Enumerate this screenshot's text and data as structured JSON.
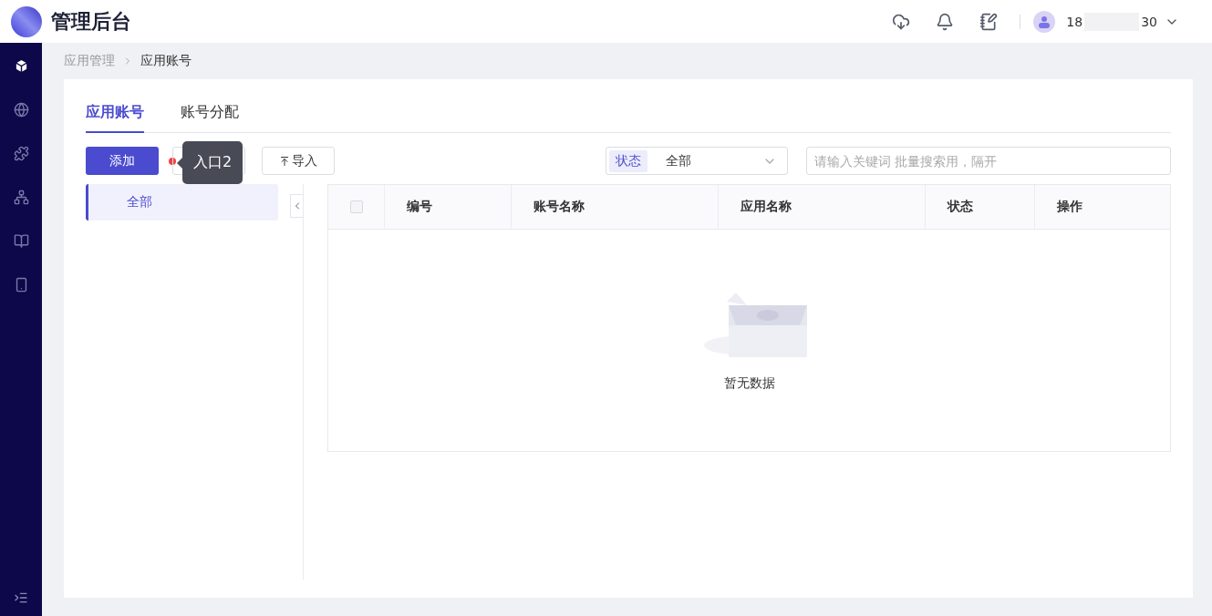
{
  "header": {
    "title": "管理后台",
    "user_name_start": "18",
    "user_name_end": "30"
  },
  "sidebar": {
    "items": [
      {
        "selected": true
      },
      {
        "selected": false
      },
      {
        "selected": false
      },
      {
        "selected": false
      },
      {
        "selected": false
      },
      {
        "selected": false
      }
    ]
  },
  "breadcrumb": [
    "应用管理",
    "应用账号"
  ],
  "tabs": [
    {
      "label": "应用账号",
      "selected": true
    },
    {
      "label": "账号分配",
      "selected": false
    }
  ],
  "toolbar": {
    "add_button": "添加",
    "tooltip": "入口2",
    "import_button": "导入",
    "status_filter": {
      "label": "状态",
      "value": "全部"
    },
    "search": {
      "placeholder": "请输入关键词 批量搜索用，隔开"
    }
  },
  "groups": [
    {
      "label": "全部",
      "selected": true
    }
  ],
  "table": {
    "columns": [
      "编号",
      "账号名称",
      "应用名称",
      "状态",
      "操作"
    ],
    "checked": false,
    "empty_text": "暂无数据"
  }
}
